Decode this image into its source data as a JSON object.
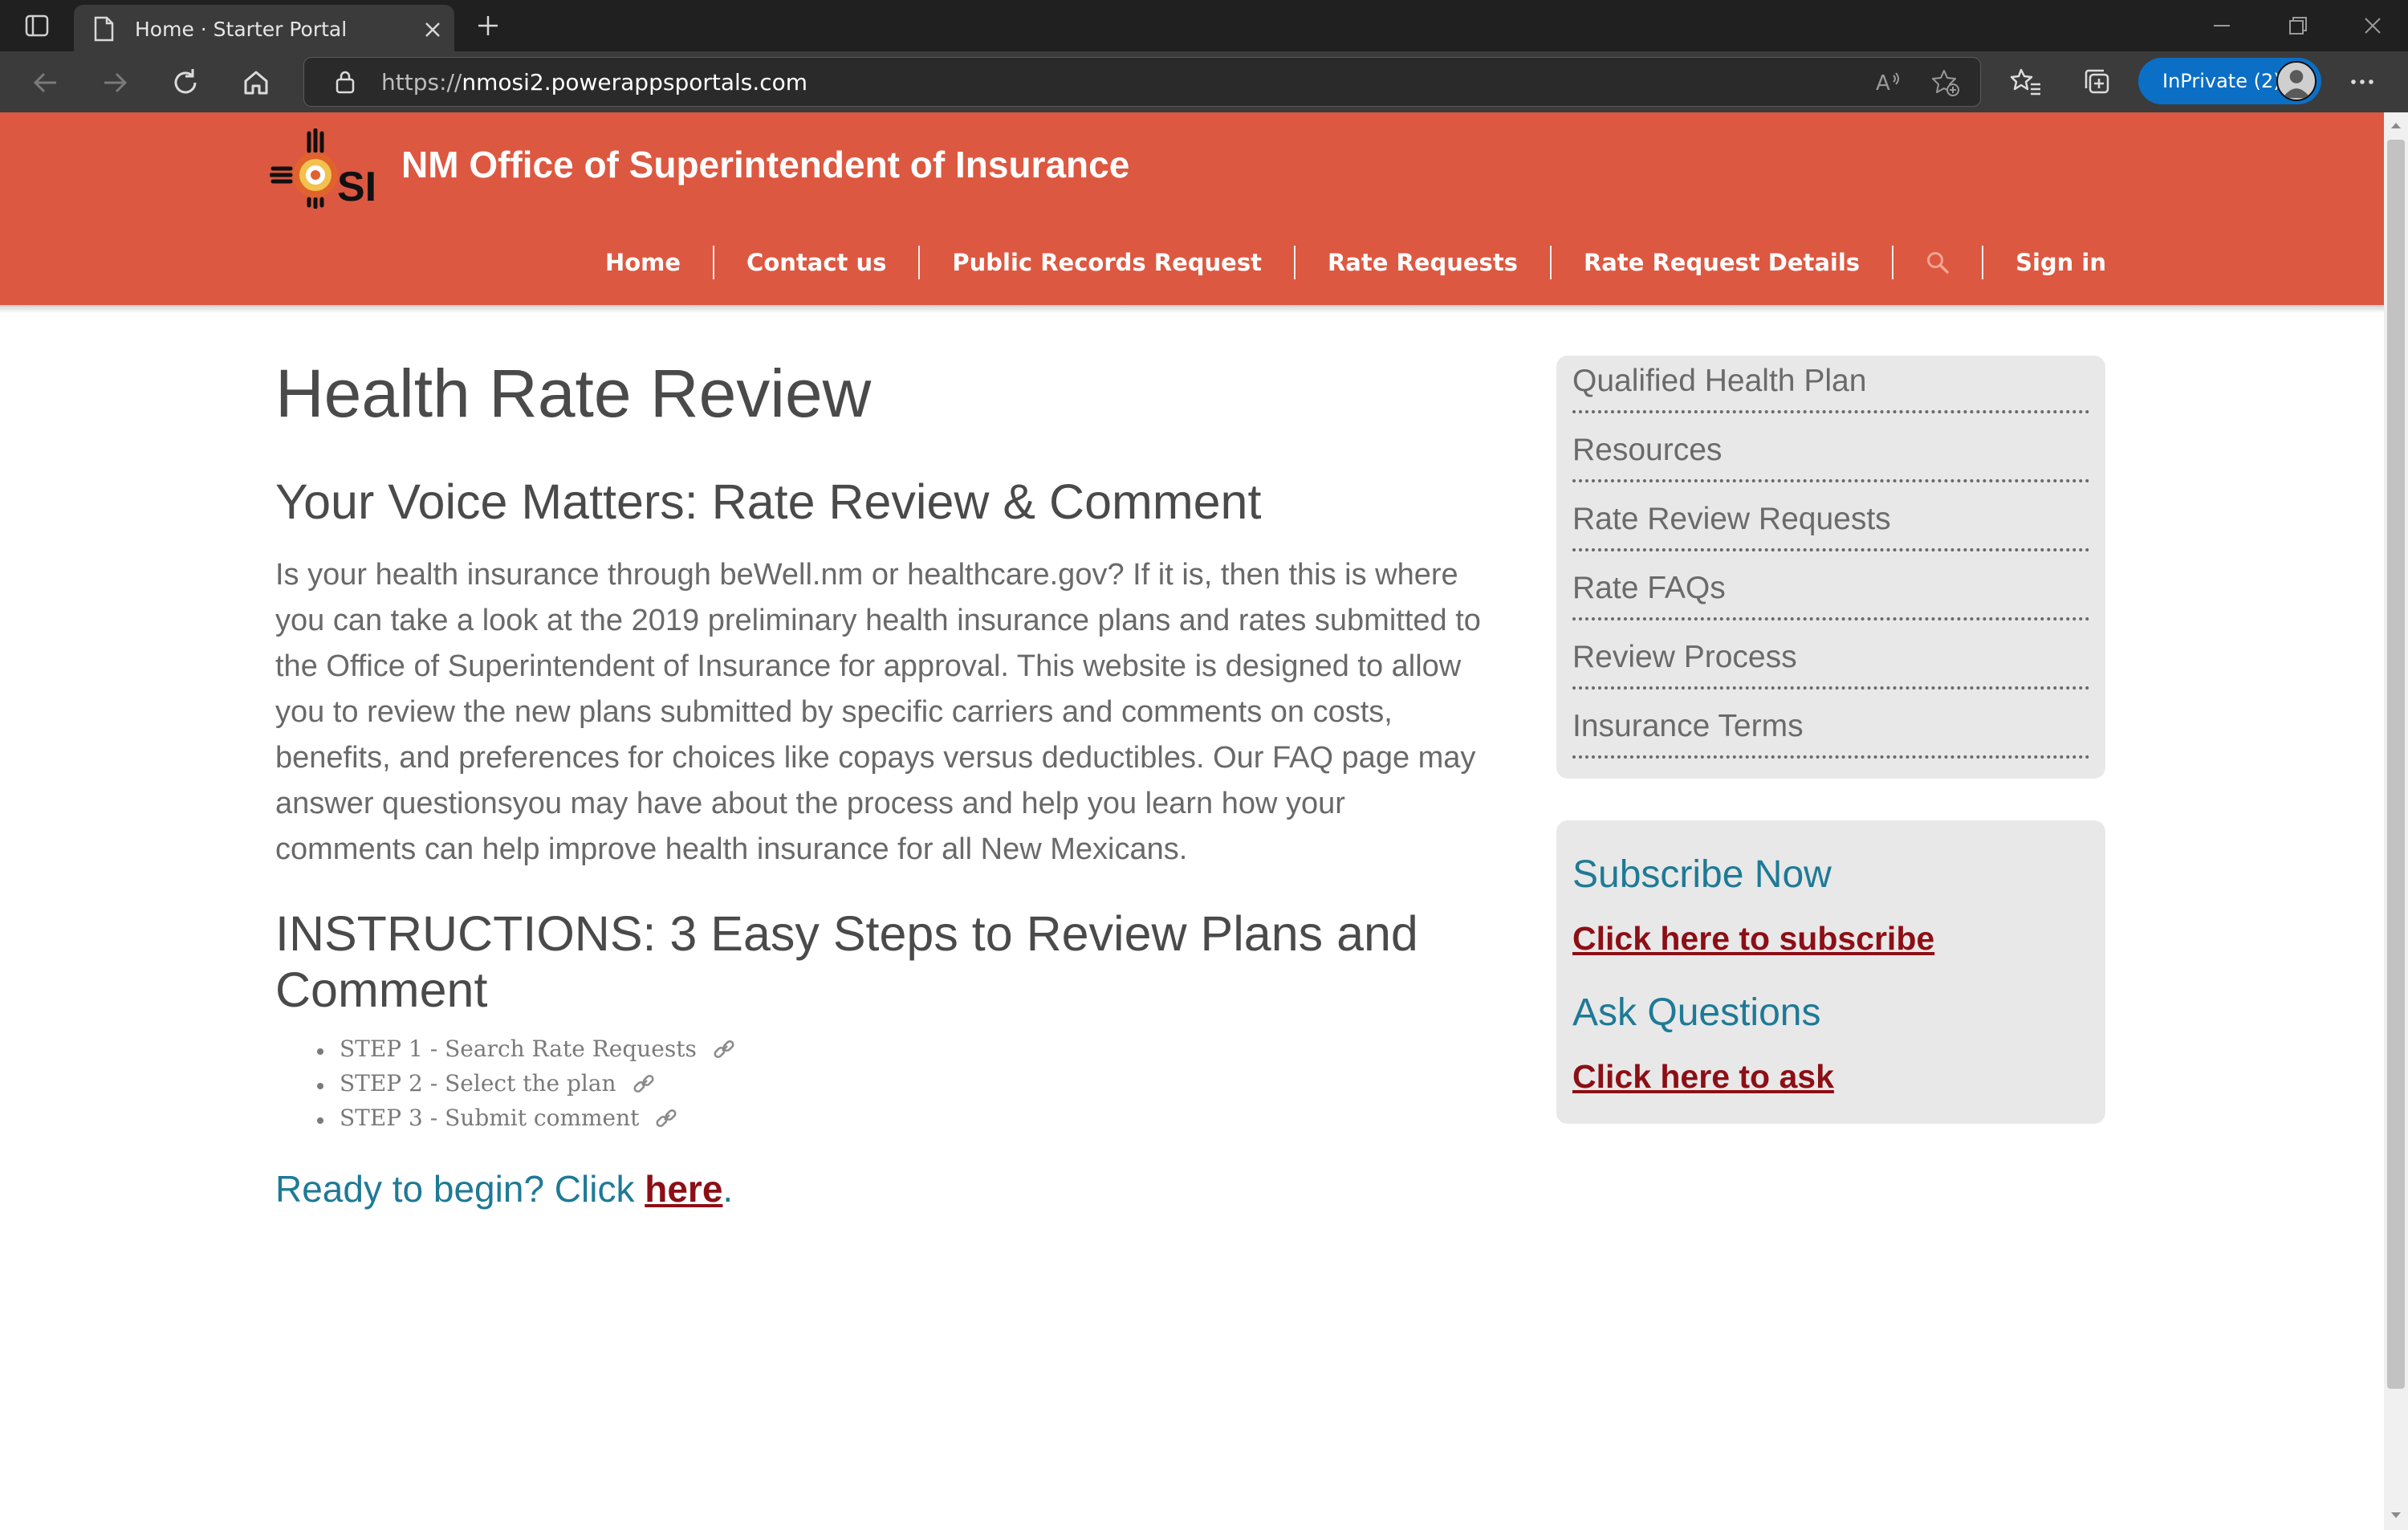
{
  "browser": {
    "tab_title": "Home  · Starter Portal",
    "url_prefix": "https://",
    "url_host": "nmosi2.powerappsportals.com",
    "inprivate_label": "InPrivate (2)"
  },
  "header": {
    "site_title": "NM Office of Superintendent of Insurance",
    "logo_icon": "osi-zia-logo",
    "nav": {
      "home": "Home",
      "contact": "Contact us",
      "public_records": "Public Records Request",
      "rate_requests": "Rate Requests",
      "rate_request_details": "Rate Request Details",
      "sign_in": "Sign in"
    }
  },
  "main": {
    "title": "Health Rate Review",
    "voice_heading": "Your Voice Matters: Rate Review & Comment",
    "intro_lines": [
      "Is your health insurance through beWell.nm or healthcare.gov? If it is, then this is where",
      "you can take a look at the 2019 preliminary health insurance plans and rates submitted to",
      "the Office of Superintendent of Insurance for approval. This website is designed to allow",
      "you to review the new plans submitted by specific carriers and comments on costs,",
      "benefits, and preferences for choices like copays versus deductibles. Our FAQ page may",
      "answer questionsyou may have about the process and help you learn how your",
      "comments can help improve health insurance for all New Mexicans."
    ],
    "instructions_heading": "INSTRUCTIONS: 3 Easy Steps to Review Plans and Comment",
    "steps": [
      "STEP 1 - Search Rate Requests",
      "STEP 2 - Select the plan",
      "STEP 3 - Submit comment"
    ],
    "ready_prefix": "Ready to begin? Click ",
    "ready_link": "here",
    "ready_suffix": "."
  },
  "sidebar": {
    "menu": [
      "Qualified Health Plan",
      "Resources",
      "Rate Review Requests",
      "Rate FAQs",
      "Review Process",
      "Insurance Terms"
    ],
    "subscribe_heading": "Subscribe Now",
    "subscribe_link": "Click here to subscribe",
    "ask_heading": "Ask Questions",
    "ask_link": "Click here to ask"
  },
  "colors": {
    "header_bg": "#dd5841",
    "heading_teal": "#1e7a96",
    "link_maroon": "#8c0f16",
    "browser_accent": "#0b6fc6"
  }
}
